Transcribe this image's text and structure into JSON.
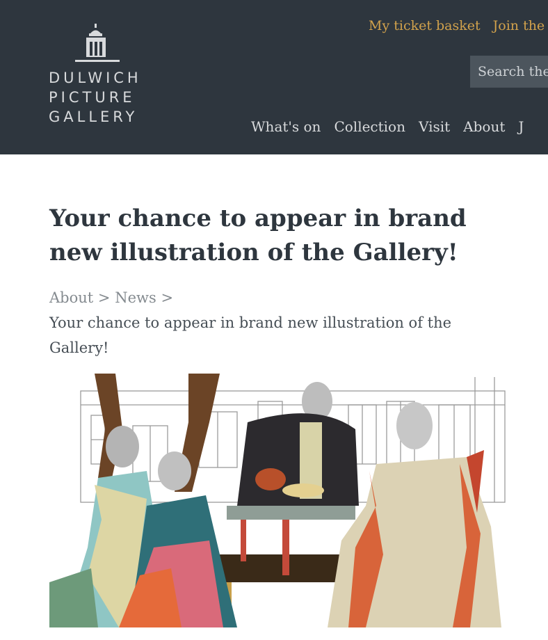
{
  "logo": {
    "lines": [
      "DULWICH",
      "PICTURE",
      "GALLERY"
    ]
  },
  "util_nav": {
    "ticket_basket": "My ticket basket",
    "join": "Join the"
  },
  "search": {
    "placeholder": "Search the"
  },
  "main_nav": {
    "items": [
      "What's on",
      "Collection",
      "Visit",
      "About",
      "J"
    ]
  },
  "article": {
    "title": "Your chance to appear in brand new illustration of the Gallery!"
  },
  "breadcrumb": {
    "items": [
      "About",
      "News"
    ],
    "separator": ">",
    "current": "Your chance to appear in brand new illustration of the Gallery!"
  },
  "colors": {
    "header_bg": "#2e363e",
    "accent": "#d2a24c",
    "search_bg": "#4c555d",
    "title": "#2e363e",
    "breadcrumb": "#858b90"
  },
  "icons": {
    "logo": "gallery-building-icon"
  }
}
